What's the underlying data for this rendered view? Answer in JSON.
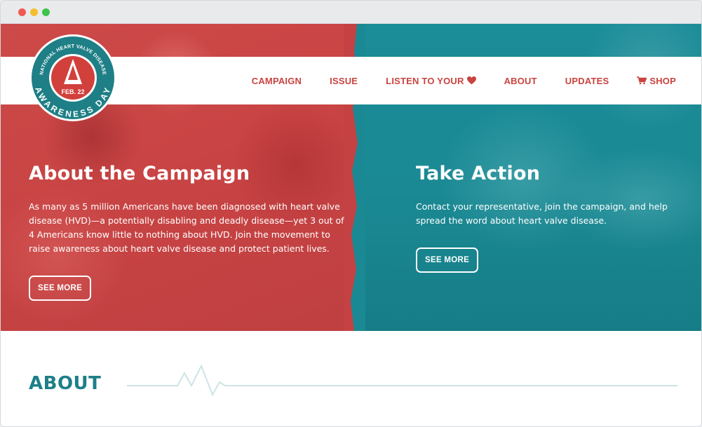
{
  "logo": {
    "arc_top": "NATIONAL HEART VALVE DISEASE",
    "date": "FEB. 22",
    "arc_bottom": "AWARENESS DAY"
  },
  "nav": {
    "items": [
      {
        "label": "CAMPAIGN"
      },
      {
        "label": "ISSUE"
      },
      {
        "label": "LISTEN TO YOUR",
        "icon": "heart-icon"
      },
      {
        "label": "ABOUT"
      },
      {
        "label": "UPDATES"
      },
      {
        "label": "SHOP",
        "icon": "cart-icon"
      }
    ]
  },
  "campaign": {
    "title": "About the Campaign",
    "body": "As many as 5 million Americans have been diagnosed with heart valve disease (HVD)—a potentially disabling and deadly disease—yet 3 out of 4 Americans know little to nothing about HVD. Join the movement to raise awareness about heart valve disease and protect patient lives.",
    "button": "SEE MORE"
  },
  "action": {
    "title": "Take Action",
    "body": "Contact your representative, join the campaign, and help spread the word about heart valve disease.",
    "button": "SEE MORE"
  },
  "about": {
    "title": "ABOUT"
  },
  "colors": {
    "brand_red": "#c9433f",
    "brand_teal": "#1a8993",
    "about_teal": "#1d7f88"
  }
}
